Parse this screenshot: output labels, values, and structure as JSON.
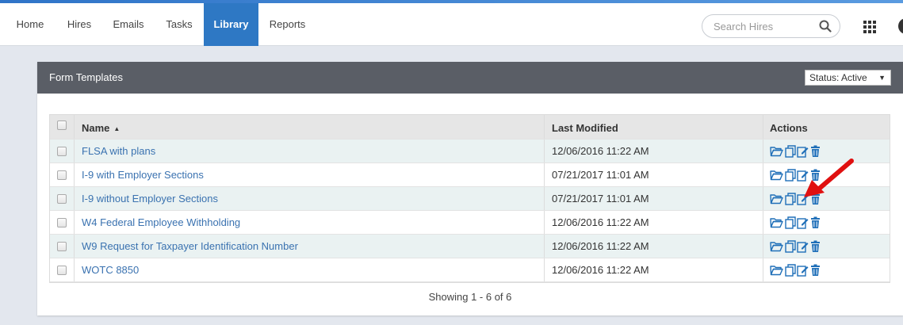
{
  "nav": {
    "items": [
      {
        "label": "Home"
      },
      {
        "label": "Hires"
      },
      {
        "label": "Emails"
      },
      {
        "label": "Tasks"
      },
      {
        "label": "Library"
      },
      {
        "label": "Reports"
      }
    ],
    "active": "Library",
    "search_placeholder": "Search Hires"
  },
  "panel": {
    "title": "Form Templates",
    "status_filter": "Status: Active"
  },
  "table": {
    "columns": {
      "name": "Name",
      "last_modified": "Last Modified",
      "actions": "Actions"
    },
    "sort_column": "Name",
    "sort_direction": "ascending",
    "rows": [
      {
        "name": "FLSA with plans",
        "modified": "12/06/2016 11:22 AM"
      },
      {
        "name": "I-9 with Employer Sections",
        "modified": "07/21/2017 11:01 AM"
      },
      {
        "name": "I-9 without Employer Sections",
        "modified": "07/21/2017 11:01 AM"
      },
      {
        "name": "W4 Federal Employee Withholding",
        "modified": "12/06/2016 11:22 AM"
      },
      {
        "name": "W9 Request for Taxpayer Identification Number",
        "modified": "12/06/2016 11:22 AM"
      },
      {
        "name": "WOTC 8850",
        "modified": "12/06/2016 11:22 AM"
      }
    ],
    "row_actions": [
      "open-folder-icon",
      "copy-icon",
      "edit-icon",
      "delete-icon"
    ],
    "footer": "Showing 1 - 6 of 6"
  },
  "colors": {
    "accent": "#2e78c4",
    "header_bar": "#5a5e66",
    "link": "#3a72b0",
    "icon": "#1f6fb8",
    "annotation_arrow": "#e01010"
  }
}
